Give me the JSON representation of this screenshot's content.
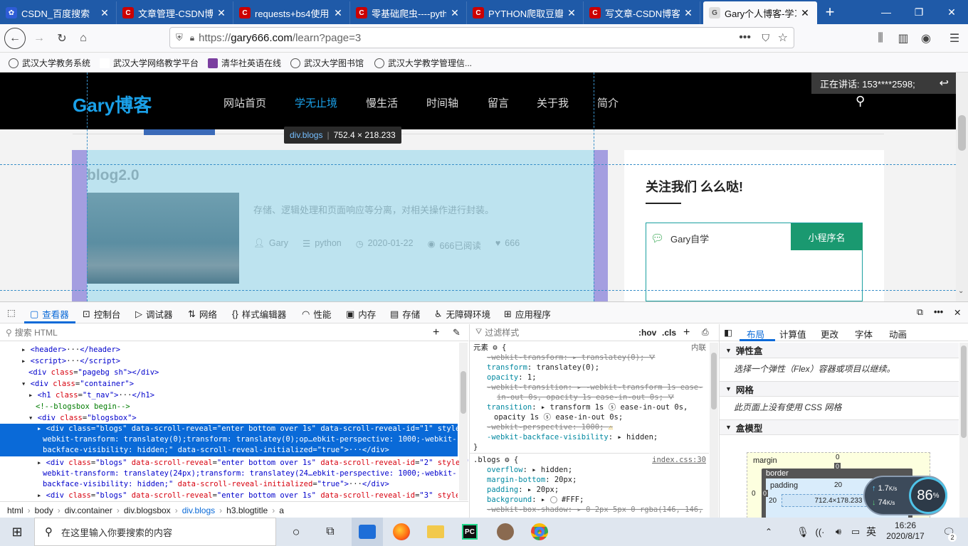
{
  "tabs": [
    {
      "title": "CSDN_百度搜索",
      "fav_color": "#2e5cd6",
      "fav_glyph": "✿"
    },
    {
      "title": "文章管理-CSDN博客",
      "fav_color": "#c00",
      "fav_glyph": "C"
    },
    {
      "title": "requests+bs4使用",
      "fav_color": "#c00",
      "fav_glyph": "C"
    },
    {
      "title": "零基础爬虫----pyth",
      "fav_color": "#c00",
      "fav_glyph": "C"
    },
    {
      "title": "PYTHON爬取豆瓣电",
      "fav_color": "#c00",
      "fav_glyph": "C"
    },
    {
      "title": "写文章-CSDN博客",
      "fav_color": "#c00",
      "fav_glyph": "C"
    },
    {
      "title": "Gary个人博客-学习",
      "fav_color": "#ddd",
      "fav_glyph": "G"
    }
  ],
  "new_tab": "+",
  "url": {
    "prefix": "https://",
    "host": "gary666.com",
    "path": "/learn?page=3"
  },
  "bookmarks": [
    "武汉大学教务系统",
    "武汉大学网络教学平台",
    "清华社英语在线",
    "武汉大学图书馆",
    "武汉大学教学管理信..."
  ],
  "site": {
    "logo": "Gary博客",
    "menu": [
      "网站首页",
      "学无止境",
      "慢生活",
      "时间轴",
      "留言",
      "关于我",
      "简介"
    ],
    "active_menu": 1,
    "speaking": "正在讲话: 153****2598;",
    "blog": {
      "title": "blog2.0",
      "desc": "存储、逻辑处理和页面响应等分离，对相关操作进行封装。",
      "author": "Gary",
      "category": "python",
      "date": "2020-01-22",
      "views": "666已阅读",
      "likes": "666"
    },
    "sidebar": {
      "heading": "关注我们 么么哒!",
      "tab1": "Gary自学",
      "tab2": "小程序名"
    },
    "tooltip": {
      "selector": "div.blogs",
      "size": "752.4 × 218.233"
    }
  },
  "devtools": {
    "tabs": [
      "查看器",
      "控制台",
      "调试器",
      "网络",
      "样式编辑器",
      "性能",
      "内存",
      "存储",
      "无障碍环境",
      "应用程序"
    ],
    "search_placeholder": "搜索 HTML",
    "filter_placeholder": "过滤样式",
    "hov": ":hov",
    "cls": ".cls",
    "layout_tabs": [
      "布局",
      "计算值",
      "更改",
      "字体",
      "动画"
    ],
    "breadcrumb": [
      "html",
      "body",
      "div.container",
      "div.blogsbox",
      "div.blogs",
      "h3.blogtitle",
      "a"
    ],
    "flex_title": "弹性盒",
    "flex_desc": "选择一个弹性（Flex）容器或项目以继续。",
    "grid_title": "网格",
    "grid_desc": "此页面上没有使用 CSS 网格",
    "box_title": "盒模型",
    "box": {
      "margin": "margin",
      "border": "border",
      "padding": "padding",
      "m_top": "0",
      "b_top": "0",
      "p_top": "20",
      "left0": "0",
      "left_b": "0",
      "p_left": "20",
      "content": "712.4×178.233"
    },
    "element_label": "元素",
    "inline_label": "内联",
    "blogs_rule": ".blogs",
    "blogs_src": "index.css:30",
    "net": {
      "up": "1.7",
      "down": "74",
      "unit": "K/s",
      "pct": "86"
    }
  },
  "taskbar": {
    "search": "在这里输入你要搜索的内容",
    "time": "16:26",
    "date": "2020/8/17",
    "lang": "英",
    "notif": "2"
  }
}
